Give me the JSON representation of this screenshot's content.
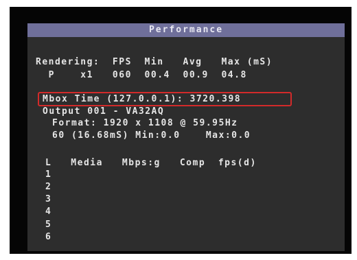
{
  "title": "Performance",
  "rendering": {
    "header": "Rendering:  FPS  Min   Avg   Max (mS)",
    "row": "  P    x1   060  00.4  00.9  04.8"
  },
  "mbox": {
    "line": "Mbox Time (127.0.0.1): 3720.398",
    "highlight_color": "#d32a2a"
  },
  "output": {
    "line": "Output 001 - VA32AQ",
    "format": "Format: 1920 x 1108 @ 59.95Hz",
    "timing": "60 (16.68mS) Min:0.0    Max:0.0"
  },
  "media": {
    "header": "L   Media   Mbps:g   Comp  fps(d)",
    "rows": [
      "1",
      "2",
      "3",
      "4",
      "5",
      "6"
    ]
  }
}
